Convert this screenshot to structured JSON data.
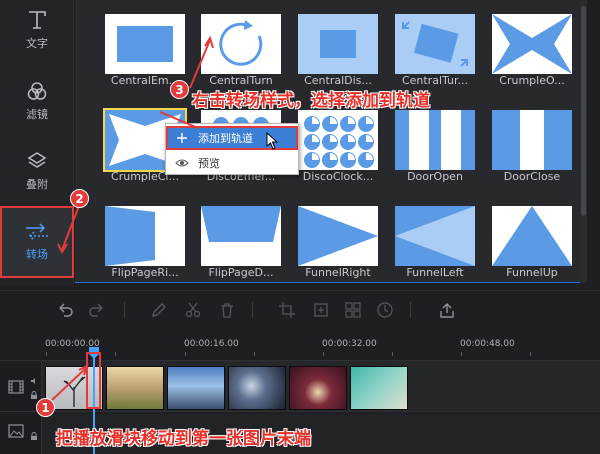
{
  "sidebar": {
    "items": [
      {
        "label": "文字",
        "icon": "text-icon"
      },
      {
        "label": "滤镜",
        "icon": "filter-icon"
      },
      {
        "label": "叠附",
        "icon": "overlay-icon"
      },
      {
        "label": "转场",
        "icon": "transition-icon"
      }
    ]
  },
  "transitions": {
    "rows": [
      [
        "CentralEm...",
        "CentralTurn",
        "CentralDis...",
        "CentralTur...",
        "CrumpleO..."
      ],
      [
        "CrumpleCl...",
        "DiscoEmer...",
        "DiscoClock...",
        "DoorOpen",
        "DoorClose"
      ],
      [
        "FlipPageRi...",
        "FlipPageD...",
        "FunnelRight",
        "FunnelLeft",
        "FunnelUp"
      ]
    ]
  },
  "context_menu": {
    "add_label": "添加到轨道",
    "preview_label": "预览"
  },
  "timeline": {
    "times": [
      "00:00:00.00",
      "00:00:16.00",
      "00:00:32.00",
      "00:00:48.00"
    ]
  },
  "annotations": {
    "step1_number": "1",
    "step1_text": "把播放滑块移动到第一张图片末端",
    "step2_number": "2",
    "step3_number": "3",
    "step3_text": "右击转场样式，选择添加到轨道"
  },
  "colors": {
    "accent": "#4aa0ff",
    "annotation_red": "#e23b3b",
    "tile_blue": "#5b9be6",
    "menu_highlight": "#3c7fd6"
  }
}
